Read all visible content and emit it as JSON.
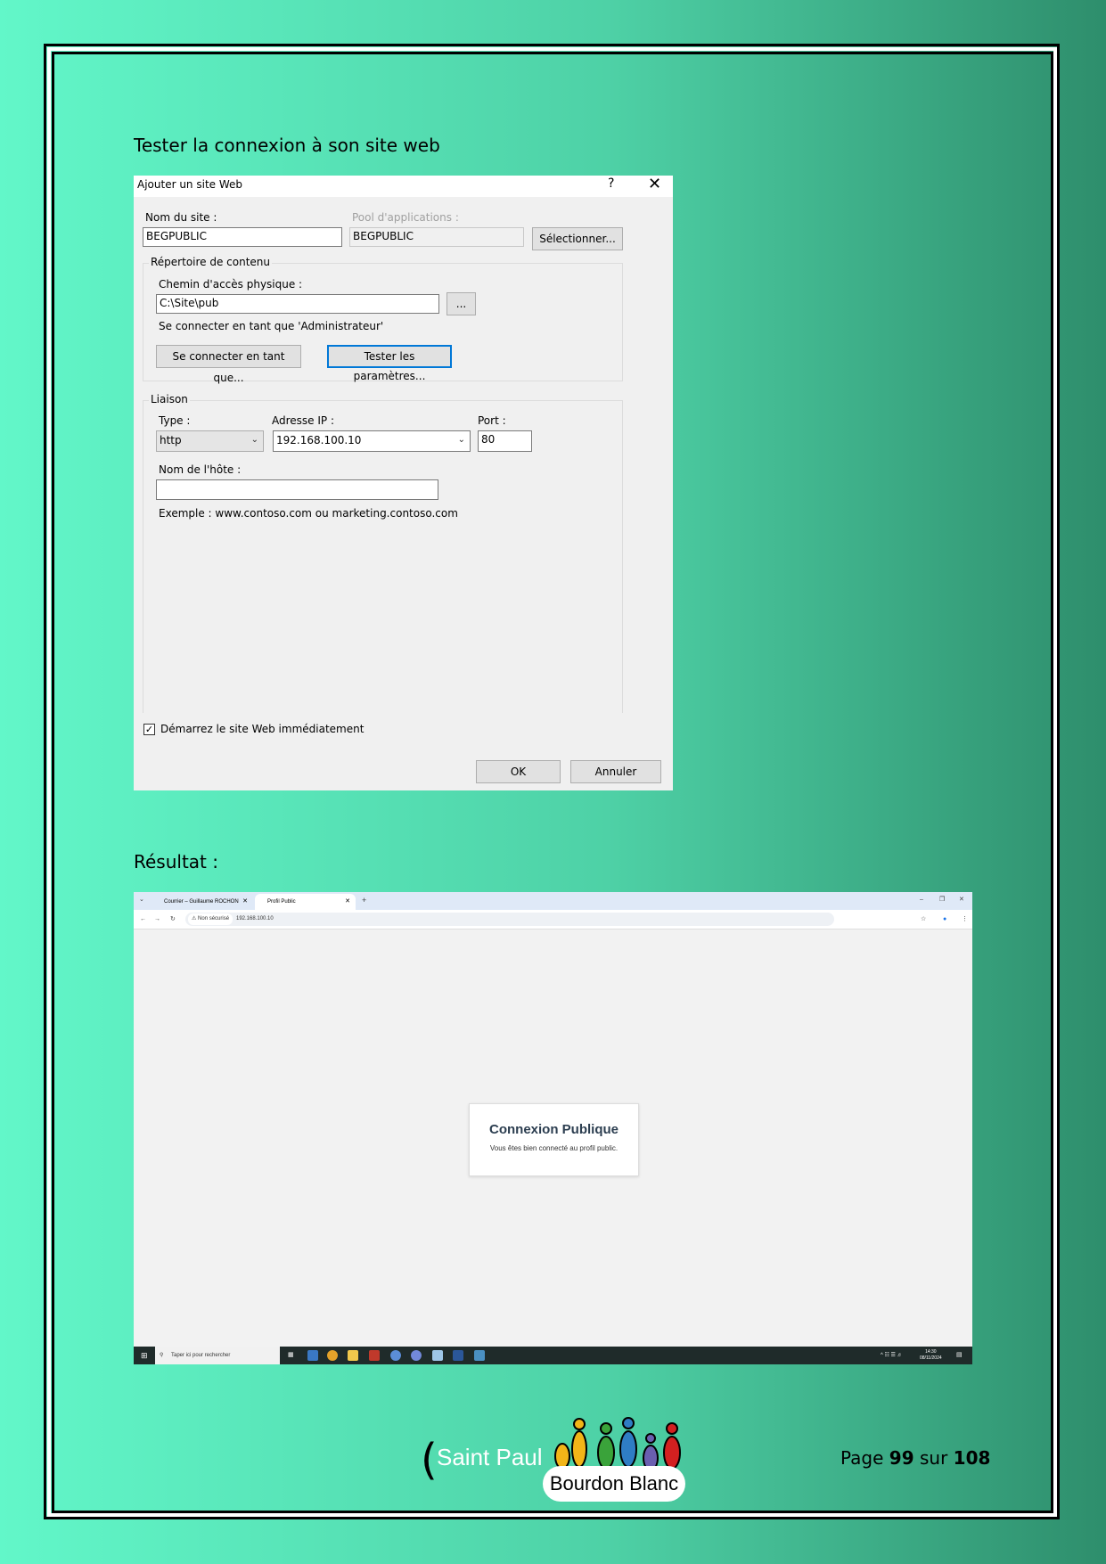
{
  "section_title": "Tester la connexion à son site web",
  "result_title": "Résultat :",
  "dialog": {
    "title": "Ajouter un site Web",
    "help": "?",
    "close": "✕",
    "site_name_label": "Nom du site :",
    "site_name_value": "BEGPUBLIC",
    "pool_label": "Pool d'applications :",
    "pool_value": "BEGPUBLIC",
    "select_button": "Sélectionner...",
    "content_group": "Répertoire de contenu",
    "physical_path_label": "Chemin d'accès physique :",
    "physical_path_value": "C:\\Site\\pub",
    "browse_button": "...",
    "connect_as_info": "Se connecter en tant que 'Administrateur'",
    "connect_as_button": "Se connecter en tant que...",
    "test_settings_button": "Tester les paramètres...",
    "binding_group": "Liaison",
    "type_label": "Type :",
    "type_value": "http",
    "ip_label": "Adresse IP :",
    "ip_value": "192.168.100.10",
    "port_label": "Port :",
    "port_value": "80",
    "hostname_label": "Nom de l'hôte :",
    "hostname_value": "",
    "example_text": "Exemple : www.contoso.com ou marketing.contoso.com",
    "start_checkbox_label": "Démarrez le site Web immédiatement",
    "start_checked": true,
    "ok_button": "OK",
    "cancel_button": "Annuler"
  },
  "browser": {
    "tab1": "Courrier – Guillaume ROCHON",
    "tab2": "Profil Public",
    "new_tab": "+",
    "not_secure": "Non sécurisé",
    "url": "192.168.100.10",
    "card_title": "Connexion Publique",
    "card_text": "Vous êtes bien connecté au profil public.",
    "taskbar_search": "Taper ici pour rechercher",
    "time": "14:30",
    "date": "08/11/2024"
  },
  "footer": {
    "school_name": "Saint Paul",
    "logo_text": "Bourdon Blanc",
    "page_prefix": "Page",
    "page_number": "99",
    "page_sep": "sur",
    "page_total": "108"
  },
  "colors": {
    "accent": "#0078d7",
    "card_title": "#2c3e50"
  }
}
